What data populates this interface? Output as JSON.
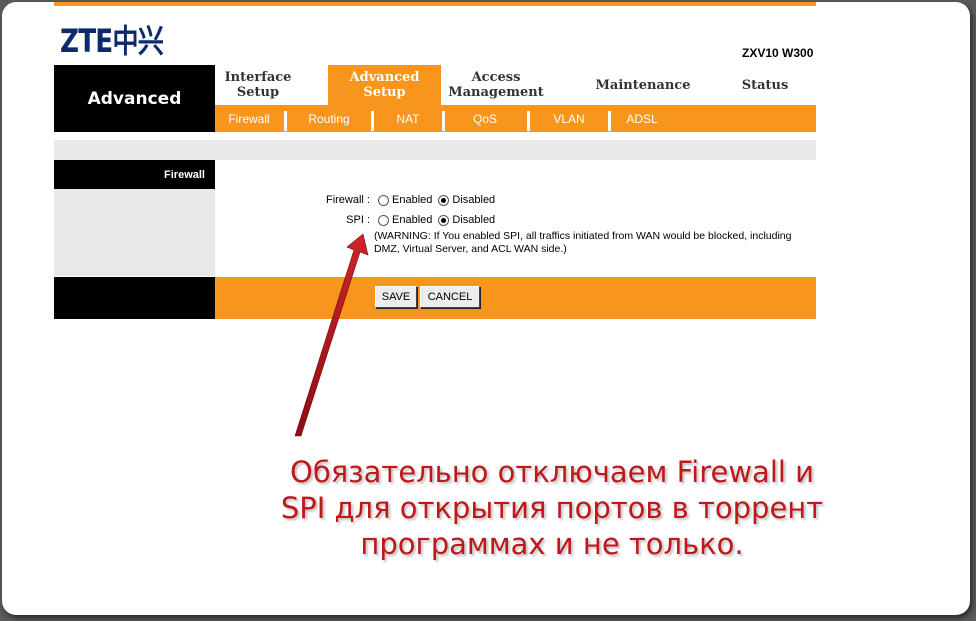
{
  "brand": {
    "logo_text": "ZTE中兴",
    "model": "ZXV10 W300"
  },
  "sidebar": {
    "title": "Advanced",
    "section": "Firewall"
  },
  "nav": {
    "tabs": [
      {
        "label": "Interface\nSetup",
        "active": false
      },
      {
        "label": "Advanced\nSetup",
        "active": true
      },
      {
        "label": "Access\nManagement",
        "active": false
      },
      {
        "label": "Maintenance",
        "active": false
      },
      {
        "label": "Status",
        "active": false
      }
    ],
    "subtabs": [
      "Firewall",
      "Routing",
      "NAT",
      "QoS",
      "VLAN",
      "ADSL"
    ]
  },
  "form": {
    "firewall": {
      "label": "Firewall :",
      "options": [
        "Enabled",
        "Disabled"
      ],
      "selected": "Disabled"
    },
    "spi": {
      "label": "SPI :",
      "options": [
        "Enabled",
        "Disabled"
      ],
      "selected": "Disabled"
    },
    "warning": "(WARNING: If You enabled SPI, all traffics initiated from WAN would be blocked, including DMZ, Virtual Server, and ACL WAN side.)"
  },
  "buttons": {
    "save": "SAVE",
    "cancel": "CANCEL"
  },
  "annotation": {
    "lines": [
      "Обязательно отключаем Firewall и",
      "SPI для открытия портов в торрент",
      "программах и не только."
    ]
  },
  "colors": {
    "accent": "#f7951d",
    "annotation": "#c0181a",
    "arrow": "#b5121b"
  }
}
